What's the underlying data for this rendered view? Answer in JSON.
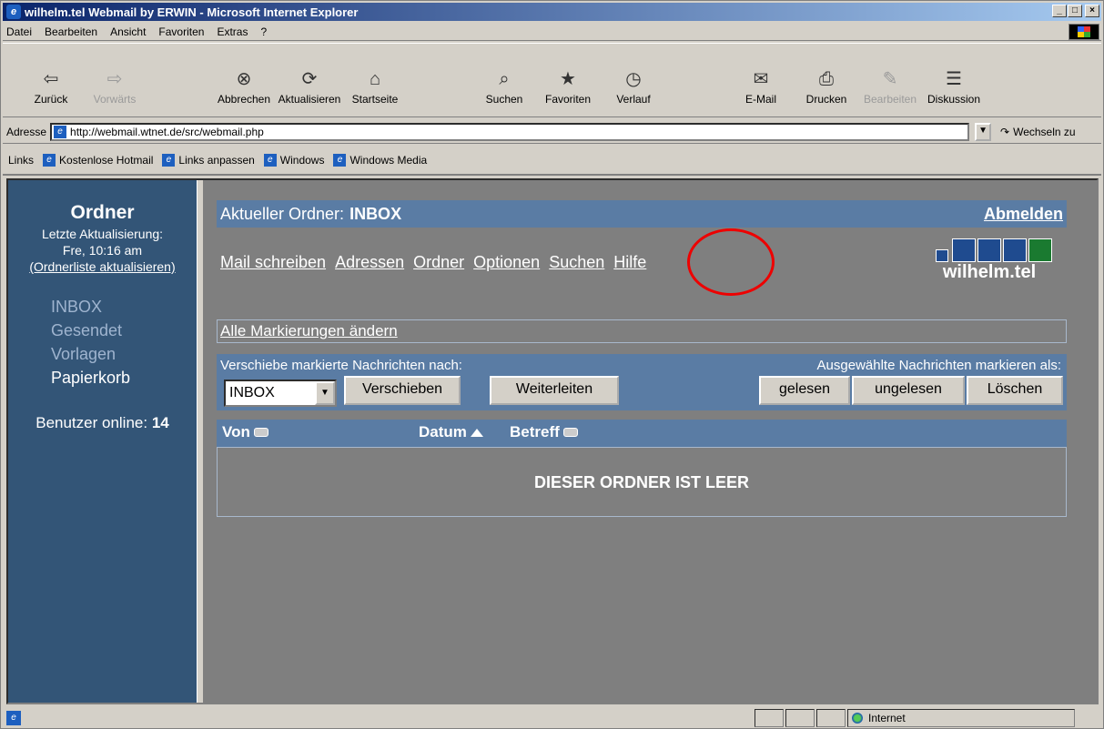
{
  "window": {
    "title": "wilhelm.tel Webmail by ERWIN - Microsoft Internet Explorer",
    "min_label": "_",
    "max_label": "□",
    "close_label": "×"
  },
  "menu": [
    "Datei",
    "Bearbeiten",
    "Ansicht",
    "Favoriten",
    "Extras",
    "?"
  ],
  "toolbar": [
    {
      "label": "Zurück",
      "icon": "back-arrow-icon",
      "glyph": "⇦",
      "enabled": true
    },
    {
      "label": "Vorwärts",
      "icon": "forward-arrow-icon",
      "glyph": "⇨",
      "enabled": false
    },
    {
      "label": "Abbrechen",
      "icon": "stop-icon",
      "glyph": "⊗",
      "enabled": true
    },
    {
      "label": "Aktualisieren",
      "icon": "refresh-icon",
      "glyph": "⟳",
      "enabled": true
    },
    {
      "label": "Startseite",
      "icon": "home-icon",
      "glyph": "⌂",
      "enabled": true
    },
    {
      "label": "Suchen",
      "icon": "search-icon",
      "glyph": "⌕",
      "enabled": true
    },
    {
      "label": "Favoriten",
      "icon": "favorites-icon",
      "glyph": "★",
      "enabled": true
    },
    {
      "label": "Verlauf",
      "icon": "history-icon",
      "glyph": "◷",
      "enabled": true
    },
    {
      "label": "E-Mail",
      "icon": "mail-icon",
      "glyph": "✉",
      "enabled": true
    },
    {
      "label": "Drucken",
      "icon": "print-icon",
      "glyph": "⎙",
      "enabled": true
    },
    {
      "label": "Bearbeiten",
      "icon": "edit-icon",
      "glyph": "✎",
      "enabled": false
    },
    {
      "label": "Diskussion",
      "icon": "discussion-icon",
      "glyph": "☰",
      "enabled": true
    }
  ],
  "address": {
    "label": "Adresse",
    "url": "http://webmail.wtnet.de/src/webmail.php",
    "go_label": "Wechseln zu"
  },
  "links": {
    "label": "Links",
    "items": [
      "Kostenlose Hotmail",
      "Links anpassen",
      "Windows",
      "Windows Media"
    ]
  },
  "sidebar": {
    "title": "Ordner",
    "last_update_label": "Letzte Aktualisierung:",
    "last_update_value": "Fre, 10:16 am",
    "refresh_link": "(Ordnerliste aktualisieren)",
    "folders": [
      "INBOX",
      "Gesendet",
      "Vorlagen",
      "Papierkorb"
    ],
    "users_label": "Benutzer online:",
    "users_count": "14"
  },
  "main": {
    "current_folder_label": "Aktueller Ordner:",
    "current_folder": "INBOX",
    "logout": "Abmelden",
    "nav": [
      "Mail schreiben",
      "Adressen",
      "Ordner",
      "Optionen",
      "Suchen",
      "Hilfe"
    ],
    "logo_text": "wilhelm.tel",
    "logo_colors": [
      "#1f4b8f",
      "#1f4b8f",
      "#1f4b8f",
      "#1a7a30"
    ],
    "toggle_all": "Alle Markierungen ändern",
    "move_label": "Verschiebe markierte Nachrichten nach:",
    "move_select": "INBOX",
    "move_button": "Verschieben",
    "forward_button": "Weiterleiten",
    "mark_label": "Ausgewählte Nachrichten markieren als:",
    "mark_read": "gelesen",
    "mark_unread": "ungelesen",
    "delete": "Löschen",
    "columns": [
      "Von",
      "Datum",
      "Betreff"
    ],
    "empty_message": "DIESER ORDNER IST LEER"
  },
  "statusbar": {
    "zone": "Internet"
  },
  "colors": {
    "sidebar_bg": "#335577",
    "header_bg": "#5a7ca4",
    "content_bg": "#7f7f7f",
    "highlight_circle": "#e00000"
  }
}
